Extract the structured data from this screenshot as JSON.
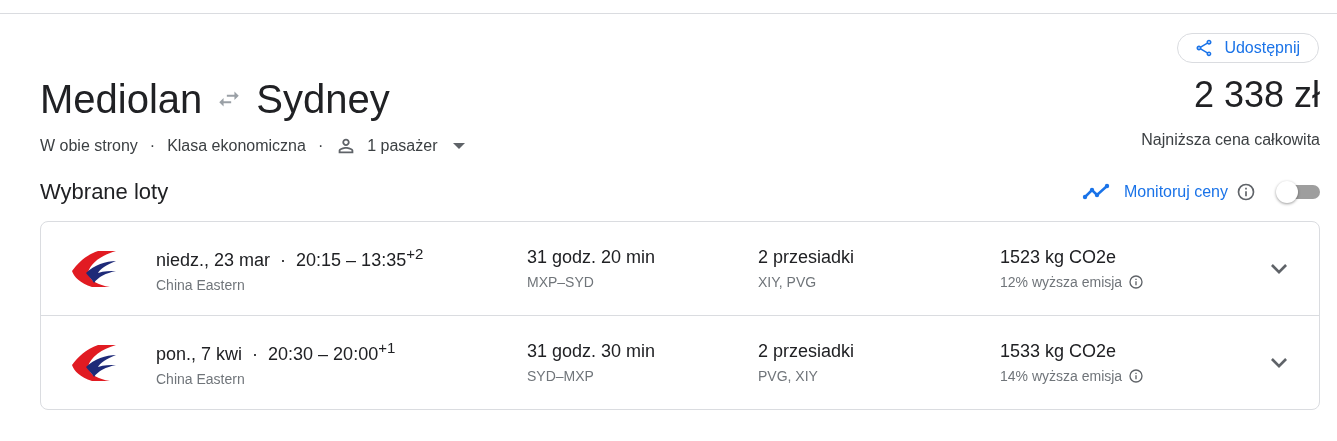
{
  "share_button": {
    "label": "Udostępnij"
  },
  "route": {
    "origin": "Mediolan",
    "destination": "Sydney"
  },
  "price": {
    "amount": "2 338 zł",
    "caption": "Najniższa cena całkowita"
  },
  "options": [
    {
      "kind": "text",
      "label": "W obie strony"
    },
    {
      "kind": "separator",
      "label": "·"
    },
    {
      "kind": "text",
      "label": "Klasa ekonomiczna"
    },
    {
      "kind": "separator",
      "label": "·"
    },
    {
      "kind": "passengers",
      "label": "1 pasażer"
    }
  ],
  "section_title": "Wybrane loty",
  "price_tracking": {
    "label": "Monitoruj ceny",
    "on": false
  },
  "flights": [
    {
      "date": "niedz., 23 mar",
      "separator": "·",
      "times": "20:15 – 13:35$^{+2}$",
      "airline": "China Eastern",
      "duration": "31 godz. 20 min",
      "route": "MXP–SYD",
      "stops": "2 przesiadki",
      "stop_airports": "XIY, PVG",
      "emissions": "1523 kg CO2e",
      "emissions_note": "12% wyższa emisja",
      "expanded": false
    },
    {
      "date": "pon., 7 kwi",
      "separator": "·",
      "times": "20:30 – 20:00$^{+1}$",
      "airline": "China Eastern",
      "duration": "31 godz. 30 min",
      "route": "SYD–MXP",
      "stops": "2 przesiadki",
      "stop_airports": "PVG, XIY",
      "emissions": "1533 kg CO2e",
      "emissions_note": "14% wyższa emisja",
      "expanded": false
    }
  ]
}
